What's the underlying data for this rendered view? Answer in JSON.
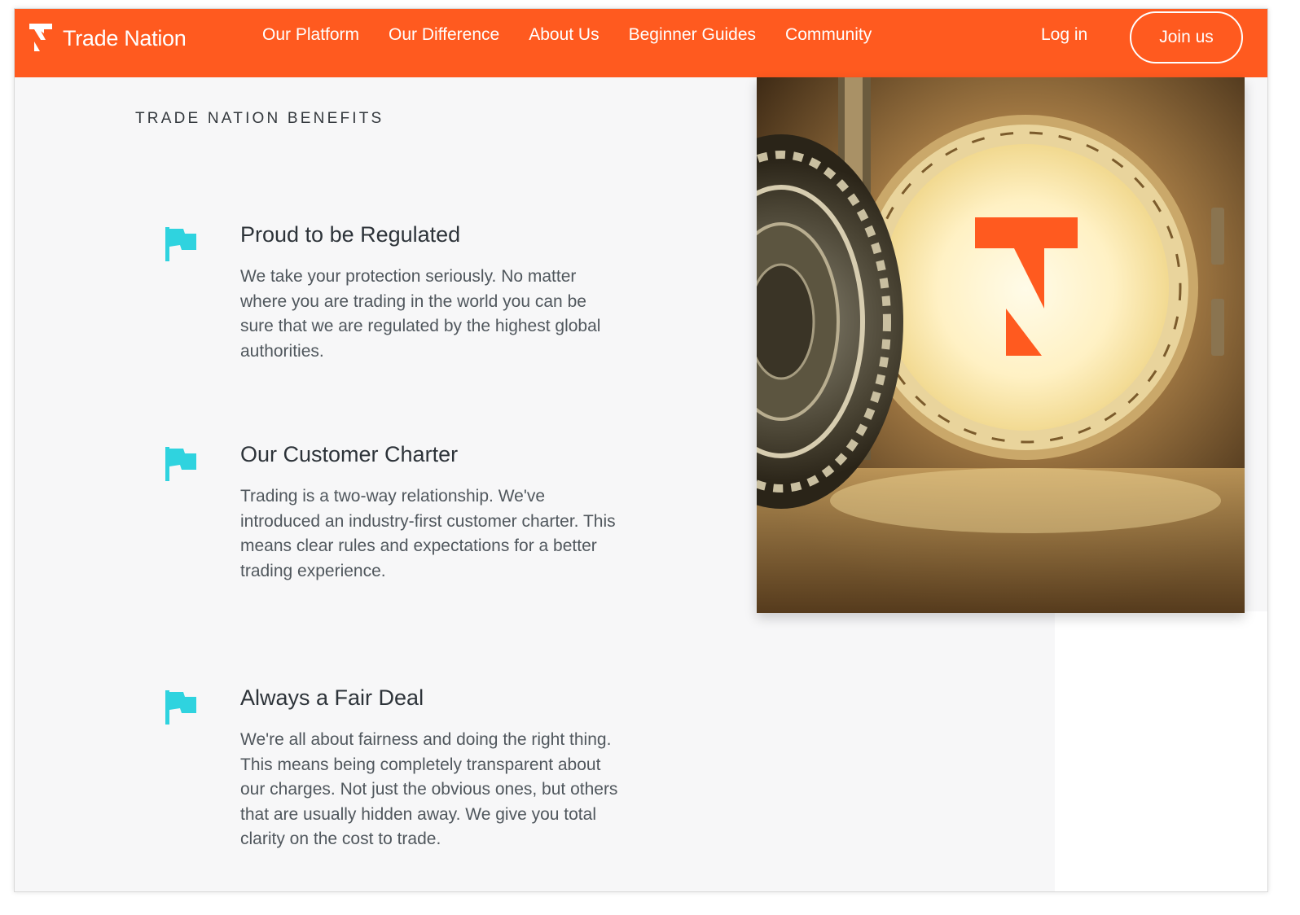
{
  "brand": {
    "name": "Trade Nation",
    "primary_color": "#ff5a1f",
    "accent_color": "#2fd3df"
  },
  "nav": {
    "links": [
      "Our Platform",
      "Our Difference",
      "About Us",
      "Beginner Guides",
      "Community"
    ],
    "login_label": "Log in",
    "join_label": "Join us"
  },
  "section": {
    "label": "TRADE NATION BENEFITS"
  },
  "benefits": [
    {
      "icon": "flag-icon",
      "title": "Proud to be Regulated",
      "text": "We take your protection seriously. No matter where you are trading in the world you can be sure that we are regulated by the highest global authorities."
    },
    {
      "icon": "flag-icon",
      "title": "Our Customer Charter",
      "text": "Trading is a two-way relationship. We've introduced an industry-first customer charter. This means clear rules and expectations for a better trading experience."
    },
    {
      "icon": "flag-icon",
      "title": "Always a Fair Deal",
      "text": "We're all about fairness and doing the right thing. This means being completely transparent about our charges. Not just the obvious ones, but others that are usually hidden away. We give you total clarity on the cost to trade."
    }
  ],
  "hero_image": {
    "subject": "vault-door-with-logo"
  }
}
